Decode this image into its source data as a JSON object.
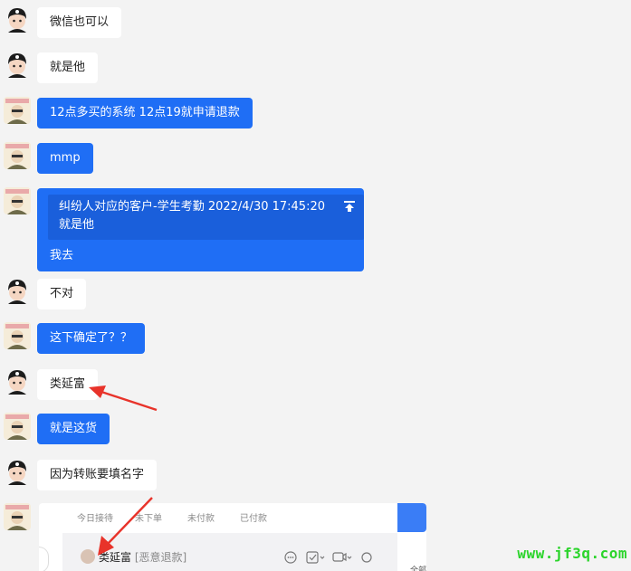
{
  "chat": {
    "messages": [
      {
        "sender": "other",
        "text": "微信也可以"
      },
      {
        "sender": "other",
        "text": "就是他"
      },
      {
        "sender": "self",
        "text": "12点多买的系统 12点19就申请退款"
      },
      {
        "sender": "self",
        "text": "mmp"
      },
      {
        "sender": "self",
        "quote": {
          "line1": "纠纷人对应的客户-学生考勤  2022/4/30 17:45:20",
          "line2": "就是他"
        },
        "text": "我去"
      },
      {
        "sender": "other",
        "text": "不对"
      },
      {
        "sender": "self",
        "text": "这下确定了？？"
      },
      {
        "sender": "other",
        "text": "类延富"
      },
      {
        "sender": "self",
        "text": "就是这货"
      },
      {
        "sender": "other",
        "text": "因为转账要填名字"
      }
    ]
  },
  "embedded_screenshot": {
    "tabs": [
      "今日接待",
      "未下单",
      "未付款",
      "已付款"
    ],
    "customer_name": "类延富",
    "customer_tag": "[恶意退款]",
    "right_edge_text": "全部"
  },
  "watermark": "www.jf3q.com",
  "colors": {
    "self_bubble": "#1f6ef5",
    "other_bubble": "#ffffff",
    "background": "#f3f3f3",
    "annotation_arrow": "#e8332a",
    "watermark": "#2ad42a"
  }
}
